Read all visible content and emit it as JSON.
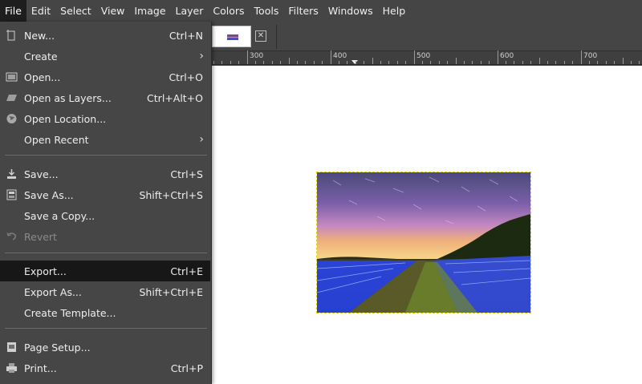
{
  "menubar": {
    "items": [
      "File",
      "Edit",
      "Select",
      "View",
      "Image",
      "Layer",
      "Colors",
      "Tools",
      "Filters",
      "Windows",
      "Help"
    ],
    "active": "File"
  },
  "ruler": {
    "labels": [
      "300",
      "400",
      "500",
      "600",
      "700"
    ]
  },
  "file_menu": {
    "new": {
      "label": "New...",
      "shortcut": "Ctrl+N",
      "icon": "new-document-icon"
    },
    "create": {
      "label": "Create",
      "icon": "submenu-arrow-icon"
    },
    "open": {
      "label": "Open...",
      "shortcut": "Ctrl+O",
      "icon": "open-image-icon"
    },
    "open_as_layers": {
      "label": "Open as Layers...",
      "shortcut": "Ctrl+Alt+O",
      "icon": "layers-icon"
    },
    "open_location": {
      "label": "Open Location...",
      "icon": "globe-icon"
    },
    "open_recent": {
      "label": "Open Recent",
      "icon": "submenu-arrow-icon"
    },
    "save": {
      "label": "Save...",
      "shortcut": "Ctrl+S",
      "icon": "save-icon"
    },
    "save_as": {
      "label": "Save As...",
      "shortcut": "Shift+Ctrl+S",
      "icon": "save-as-icon"
    },
    "save_copy": {
      "label": "Save a Copy..."
    },
    "revert": {
      "label": "Revert",
      "icon": "revert-icon",
      "disabled": true
    },
    "export": {
      "label": "Export...",
      "shortcut": "Ctrl+E",
      "highlighted": true
    },
    "export_as": {
      "label": "Export As...",
      "shortcut": "Shift+Ctrl+E"
    },
    "create_template": {
      "label": "Create Template..."
    },
    "page_setup": {
      "label": "Page Setup...",
      "icon": "page-setup-icon"
    },
    "print": {
      "label": "Print...",
      "shortcut": "Ctrl+P",
      "icon": "printer-icon"
    }
  },
  "tab": {
    "close_icon": "close-box-icon"
  },
  "colors": {
    "menu_bg": "#464646",
    "highlight": "#171717",
    "selection_outline": "#e2d400"
  }
}
